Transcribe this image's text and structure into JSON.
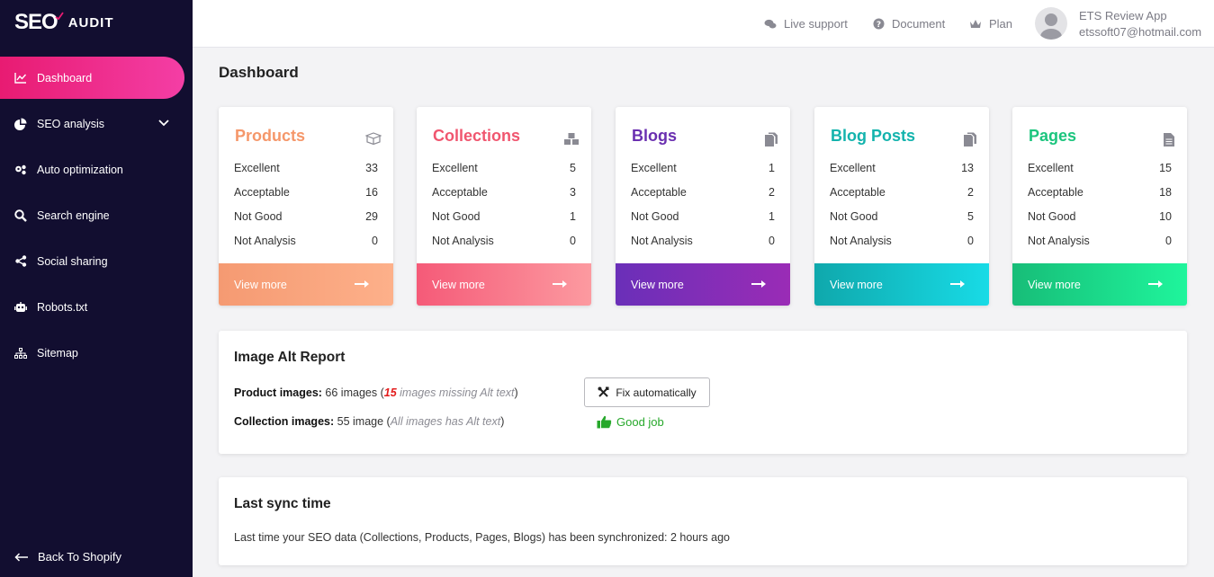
{
  "brand": {
    "logo_seo": "SEO",
    "logo_audit": "AUDIT"
  },
  "sidebar": {
    "items": [
      {
        "label": "Dashboard",
        "icon": "chart-line-icon"
      },
      {
        "label": "SEO analysis",
        "icon": "pie-chart-icon"
      },
      {
        "label": "Auto optimization",
        "icon": "gears-icon"
      },
      {
        "label": "Search engine",
        "icon": "search-icon"
      },
      {
        "label": "Social sharing",
        "icon": "share-icon"
      },
      {
        "label": "Robots.txt",
        "icon": "robot-icon"
      },
      {
        "label": "Sitemap",
        "icon": "sitemap-icon"
      }
    ],
    "back_label": "Back To Shopify"
  },
  "header": {
    "live_support": "Live support",
    "document": "Document",
    "plan": "Plan",
    "user_name": "ETS Review App",
    "user_email": "etssoft07@hotmail.com"
  },
  "page": {
    "title": "Dashboard"
  },
  "stat_labels": {
    "excellent": "Excellent",
    "acceptable": "Acceptable",
    "not_good": "Not Good",
    "not_analysis": "Not Analysis"
  },
  "cards": [
    {
      "title": "Products",
      "excellent": "33",
      "acceptable": "16",
      "not_good": "29",
      "not_analysis": "0",
      "footer": "View more",
      "color": "#f5976a"
    },
    {
      "title": "Collections",
      "excellent": "5",
      "acceptable": "3",
      "not_good": "1",
      "not_analysis": "0",
      "footer": "View more",
      "color": "#f0566f"
    },
    {
      "title": "Blogs",
      "excellent": "1",
      "acceptable": "2",
      "not_good": "1",
      "not_analysis": "0",
      "footer": "View more",
      "color": "#6a2fb0"
    },
    {
      "title": "Blog Posts",
      "excellent": "13",
      "acceptable": "2",
      "not_good": "5",
      "not_analysis": "0",
      "footer": "View more",
      "color": "#13b3ad"
    },
    {
      "title": "Pages",
      "excellent": "15",
      "acceptable": "18",
      "not_good": "10",
      "not_analysis": "0",
      "footer": "View more",
      "color": "#1cc57e"
    }
  ],
  "image_alt": {
    "title": "Image Alt Report",
    "product_label": "Product images:",
    "product_count": "66 images",
    "product_missing_num": "15",
    "product_missing_text": "images missing Alt text",
    "collection_label": "Collection images:",
    "collection_count": "55 image",
    "collection_note": "All images has Alt text",
    "fix_button": "Fix automatically",
    "good_job": "Good job"
  },
  "sync": {
    "title": "Last sync time",
    "text": "Last time your SEO data (Collections, Products, Pages, Blogs) has been synchronized: 2 hours ago"
  }
}
